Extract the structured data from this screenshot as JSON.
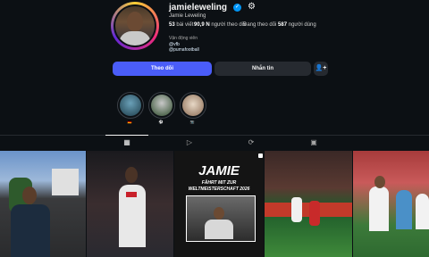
{
  "profile": {
    "username": "jamieleweling",
    "full_name": "Jamie Leweling",
    "verified_icon": "verified-badge-icon",
    "settings_icon": "gear-icon",
    "posts_count": "53",
    "posts_label": "bài viết",
    "followers_count": "90,9 N",
    "followers_label": "người theo dõi",
    "following_prefix": "Đang theo dõi",
    "following_count": "587",
    "following_label": "người dùng",
    "category": "Vận động viên",
    "link1": "@vfb",
    "link2": "@pumafootball"
  },
  "actions": {
    "follow_label": "Theo dõi",
    "message_label": "Nhắn tin",
    "add_user_icon": "add-user-icon",
    "follow_color": "#4a5df9"
  },
  "highlights": [
    {
      "label": "🇩🇪"
    },
    {
      "label": "⚽"
    },
    {
      "label": "📷"
    }
  ],
  "tabs": [
    {
      "icon": "grid-icon",
      "glyph": "▦"
    },
    {
      "icon": "reels-icon",
      "glyph": "▷"
    },
    {
      "icon": "reposts-icon",
      "glyph": "⟳"
    },
    {
      "icon": "tagged-icon",
      "glyph": "▣"
    }
  ],
  "posts": {
    "post3_title": "JAMIE",
    "post3_sub1": "FÄHRT MIT ZUR",
    "post3_sub2": "WELTMEISTERSCHAFT 2026"
  }
}
